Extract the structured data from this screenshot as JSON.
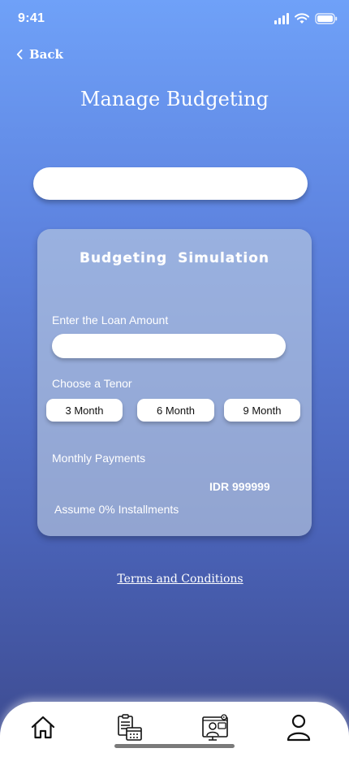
{
  "status_bar": {
    "time": "9:41"
  },
  "header": {
    "back_label": "Back",
    "title": "Manage Budgeting"
  },
  "search": {
    "value": "",
    "placeholder": ""
  },
  "simulation": {
    "title": "Budgeting  Simulation",
    "loan_label": "Enter the Loan Amount",
    "loan_value": "",
    "tenor_label": "Choose a Tenor",
    "tenors": [
      "3 Month",
      "6 Month",
      "9 Month"
    ],
    "monthly_label": "Monthly Payments",
    "monthly_amount": "IDR 999999",
    "note": "Assume 0% Installments"
  },
  "terms_link": "Terms and Conditions",
  "bottom_nav": {
    "items": [
      {
        "icon": "home-icon"
      },
      {
        "icon": "planner-icon"
      },
      {
        "icon": "consultation-icon"
      },
      {
        "icon": "profile-icon"
      }
    ]
  },
  "colors": {
    "gradient_top": "#6fa1f8",
    "gradient_bottom": "#3d4a8e",
    "card": "#bccde1"
  }
}
